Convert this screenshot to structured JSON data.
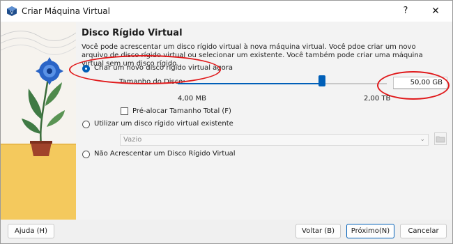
{
  "window": {
    "title": "Criar Máquina Virtual",
    "help_label": "?",
    "close_label": "✕"
  },
  "page": {
    "heading": "Disco Rígido Virtual",
    "description": "Você pode acrescentar um disco rígido virtual à nova máquina virtual. Você pdoe criar um novo arquivo de disco rígido virtual ou selecionar um existente. Você também pode criar uma máquina virtual sem um disco rígido."
  },
  "options": {
    "create_new": {
      "label": "Criar um novo disco rígido virtual agora",
      "selected": true
    },
    "disk_size_label": "Tamanho do Disco:",
    "size_value": "50,00 GB",
    "size_fraction": 0.69,
    "min_label": "4,00 MB",
    "max_label": "2,00 TB",
    "prealloc_label": "Pré-alocar Tamanho Total (F)",
    "prealloc_checked": false,
    "use_existing": {
      "label": "Utilizar um disco rígido virtual existente",
      "selected": false
    },
    "existing_value": "Vazio",
    "no_disk": {
      "label": "Não Acrescentar um Disco Rígido Virtual",
      "selected": false
    }
  },
  "footer": {
    "help": "Ajuda (H)",
    "back": "Voltar (B)",
    "next": "Próximo(N)",
    "cancel": "Cancelar"
  },
  "colors": {
    "accent": "#005fb8",
    "annotation": "#e0191b"
  },
  "icons": {
    "app": "virtualbox-icon",
    "folder": "folder-icon",
    "chevron": "chevron-down-icon"
  }
}
